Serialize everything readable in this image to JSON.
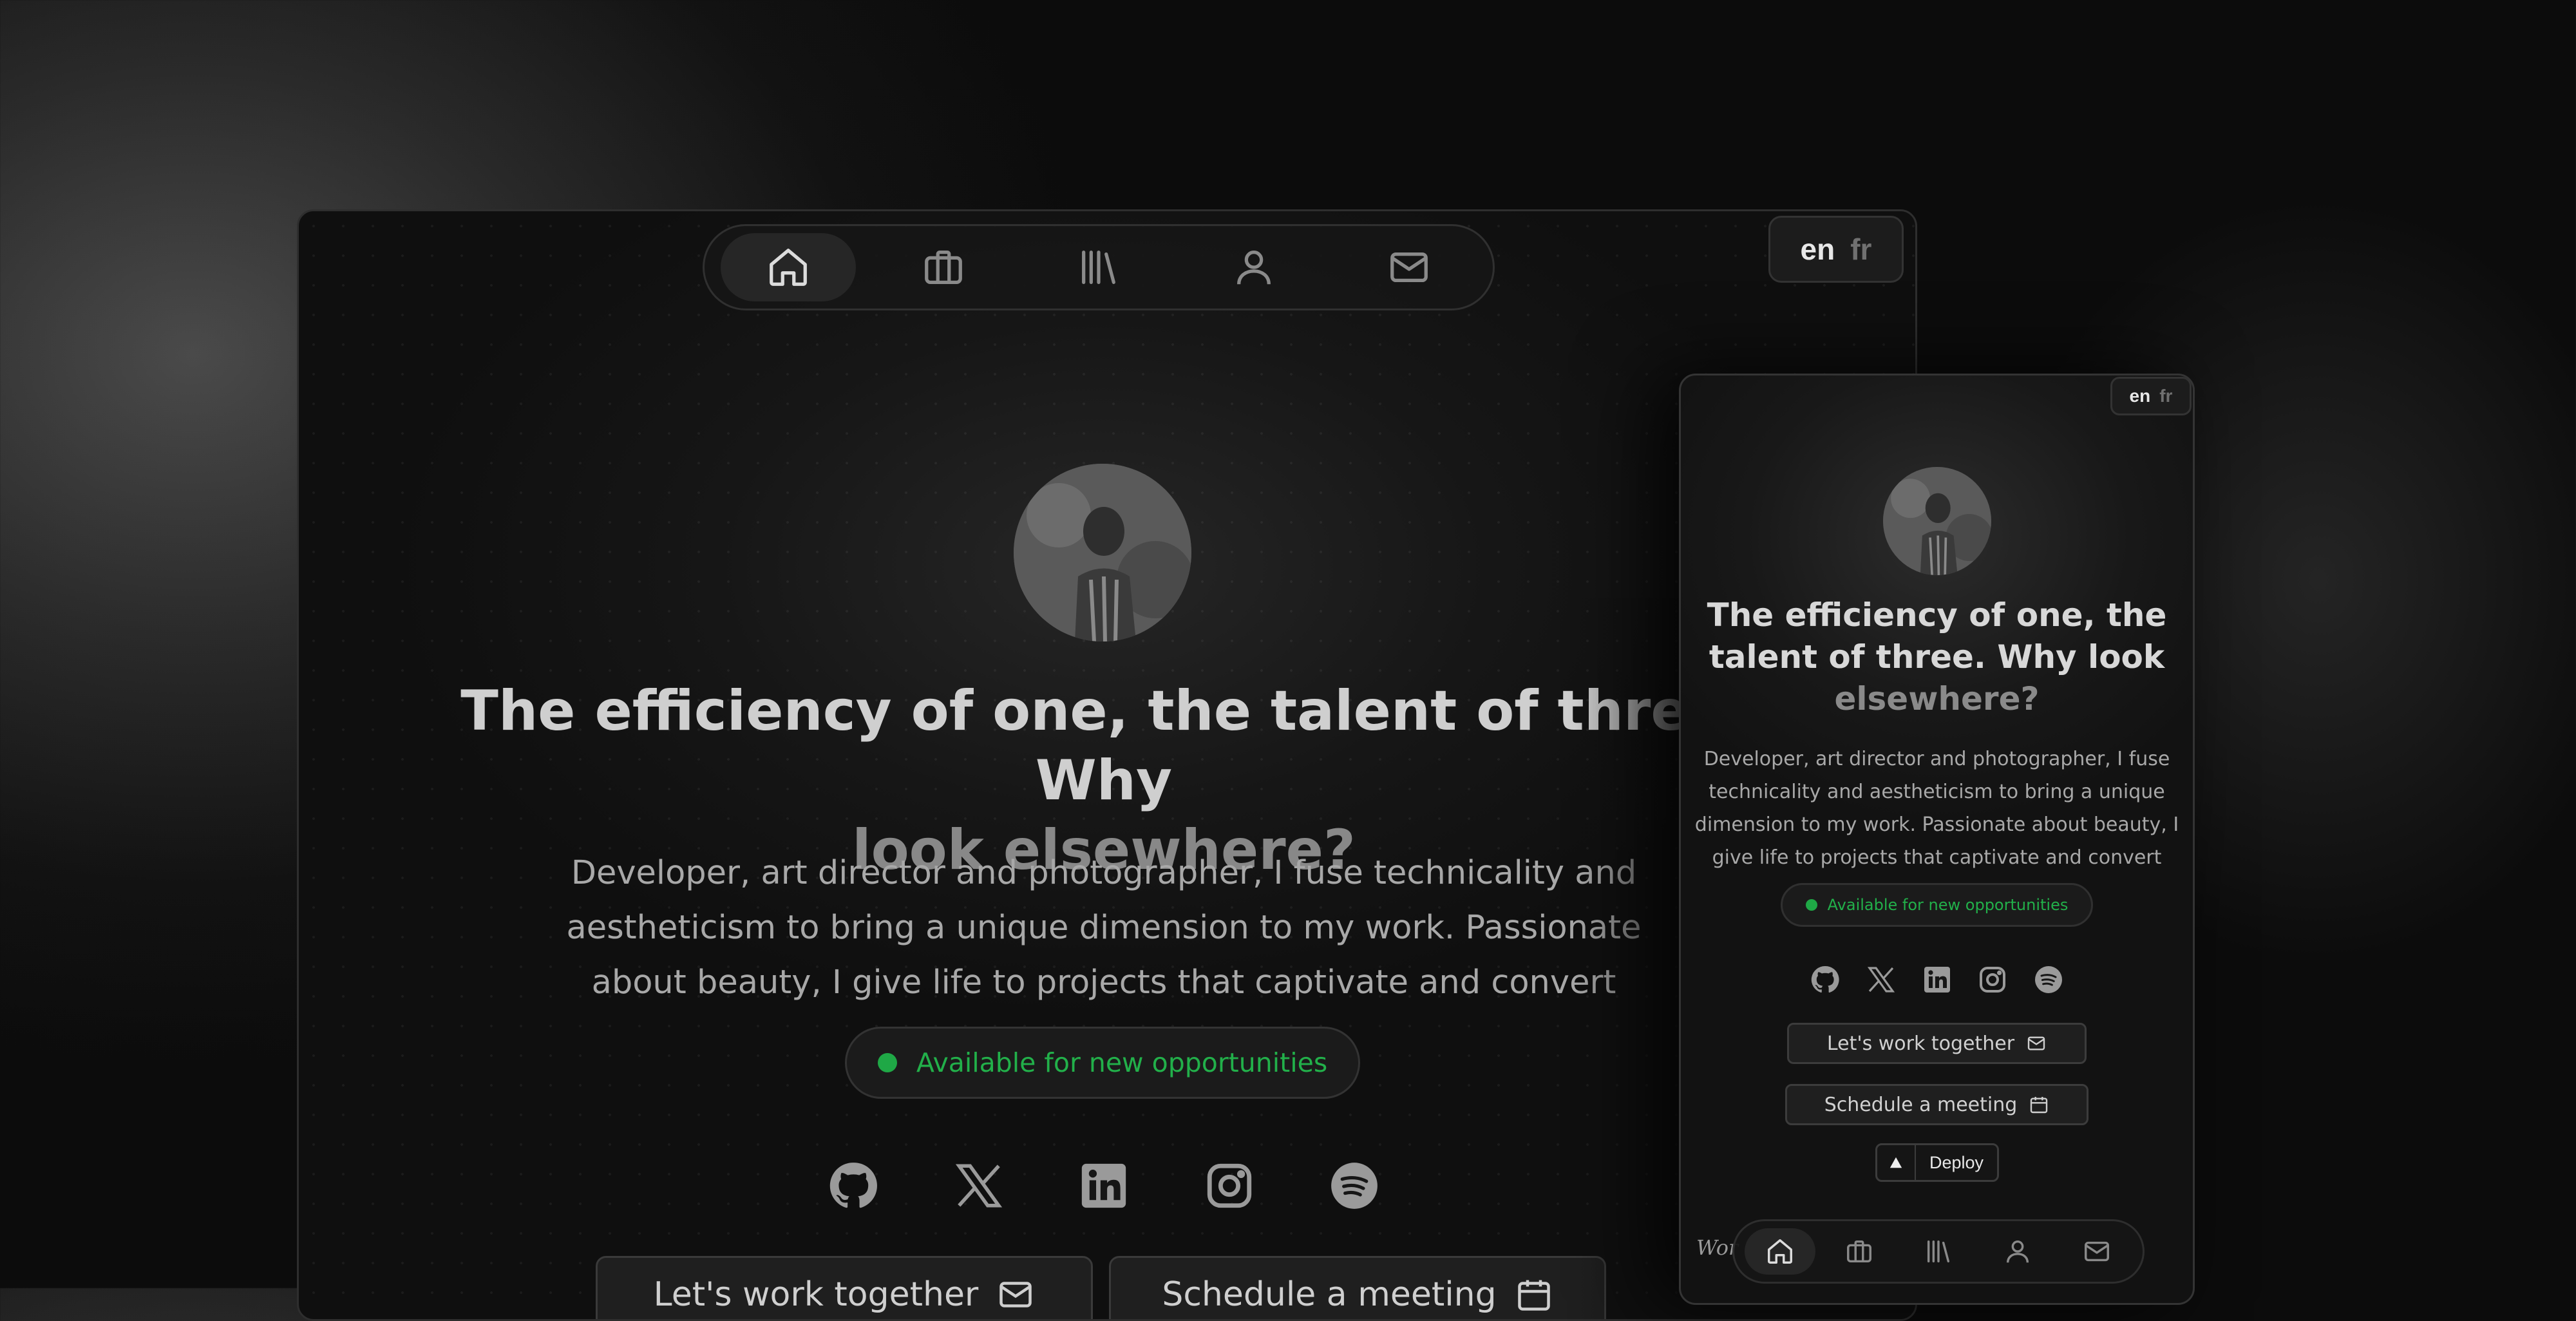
{
  "desktop": {
    "nav": {
      "items": [
        {
          "icon": "home-icon",
          "active": true
        },
        {
          "icon": "briefcase-icon",
          "active": false
        },
        {
          "icon": "library-icon",
          "active": false
        },
        {
          "icon": "user-icon",
          "active": false
        },
        {
          "icon": "mail-icon",
          "active": false
        }
      ]
    },
    "lang": {
      "en": "en",
      "fr": "fr"
    },
    "title_line1": "The efficiency of one, the talent of three. Why",
    "title_line2": "look elsewhere?",
    "desc_line1": "Developer, art director and photographer, I fuse technicality and",
    "desc_line2": "aestheticism to bring a unique dimension to my work. Passionate",
    "desc_line3": "about beauty, I give life to projects that captivate and convert",
    "availability": "Available for new opportunities",
    "socials": [
      "github-icon",
      "x-icon",
      "linkedin-icon",
      "instagram-icon",
      "spotify-icon"
    ],
    "btn_work": "Let's work together",
    "btn_meeting": "Schedule a meeting"
  },
  "mobile": {
    "lang": {
      "en": "en",
      "fr": "fr"
    },
    "title_line1": "The efficiency of one, the",
    "title_line2": "talent of three. Why look",
    "title_line3": "elsewhere?",
    "desc_line1": "Developer, art director and photographer, I fuse",
    "desc_line2": "technicality and aestheticism to bring a unique",
    "desc_line3": "dimension to my work. Passionate about beauty, I",
    "desc_line4": "give life to projects that captivate and convert",
    "availability": "Available for new opportunities",
    "btn_work": "Let's work together",
    "btn_meeting": "Schedule a meeting",
    "deploy": "Deploy",
    "partial_text": "Wor"
  },
  "colors": {
    "accent_green": "#1fa846",
    "text_primary": "#cfcfcf",
    "background": "#0f0f0f"
  }
}
